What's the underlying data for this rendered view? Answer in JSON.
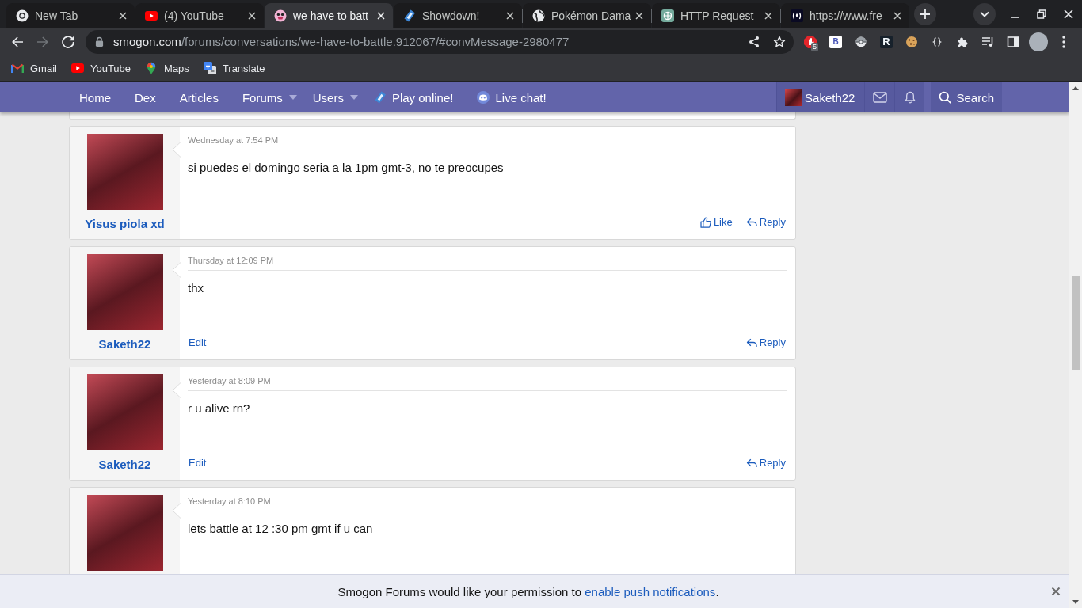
{
  "browser": {
    "tabs": [
      {
        "title": "New Tab",
        "kind": "ring",
        "selected": false
      },
      {
        "title": "(4) YouTube",
        "kind": "play",
        "selected": false
      },
      {
        "title": "we have to batt",
        "kind": "face",
        "selected": true
      },
      {
        "title": "Showdown!",
        "kind": "diamond",
        "selected": false
      },
      {
        "title": "Pokémon Dama",
        "kind": "globe",
        "selected": false
      },
      {
        "title": "HTTP Request",
        "kind": "flower",
        "selected": false
      },
      {
        "title": "https://www.fre",
        "kind": "flame",
        "selected": false
      }
    ],
    "nav_buttons": [
      {
        "kind": "back",
        "disabled": false
      },
      {
        "kind": "forward",
        "disabled": true
      },
      {
        "kind": "reload",
        "disabled": false
      }
    ],
    "address": {
      "host": "smogon.com",
      "path": "/forums/conversations/we-have-to-battle.912067/#convMessage-2980477"
    },
    "extensions": [
      {
        "kind": "stop",
        "badge": "5"
      },
      {
        "kind": "tile-light",
        "glyph": "B"
      },
      {
        "kind": "ball"
      },
      {
        "kind": "tile-dark",
        "glyph": "R"
      },
      {
        "kind": "cookie"
      },
      {
        "kind": "braces"
      }
    ],
    "bookmarks": [
      {
        "label": "Gmail",
        "kind": "mail"
      },
      {
        "label": "YouTube",
        "kind": "play"
      },
      {
        "label": "Maps",
        "kind": "pin"
      },
      {
        "label": "Translate",
        "kind": "translate"
      }
    ]
  },
  "site_nav": {
    "items": [
      {
        "label": "Home",
        "kind": "link"
      },
      {
        "label": "Dex",
        "kind": "link"
      },
      {
        "label": "Articles",
        "kind": "link"
      },
      {
        "label": "Forums",
        "kind": "dropdown"
      },
      {
        "label": "Users",
        "kind": "dropdown"
      },
      {
        "label": "Play online!",
        "kind": "showdown"
      },
      {
        "label": "Live chat!",
        "kind": "chat"
      }
    ],
    "account": {
      "username": "Saketh22"
    },
    "search": {
      "label": "Search"
    }
  },
  "messages": [
    {
      "author": "Yisus piola xd",
      "time": "Wednesday at 7:54 PM",
      "text": "si puedes el domingo seria a la 1pm gmt-3, no te preocupes",
      "actions": [
        {
          "kind": "like",
          "label": "Like"
        },
        {
          "kind": "reply",
          "label": "Reply"
        }
      ]
    },
    {
      "author": "Saketh22",
      "time": "Thursday at 12:09 PM",
      "text": "thx",
      "actions": [
        {
          "kind": "edit",
          "label": "Edit"
        },
        {
          "kind": "reply",
          "label": "Reply"
        }
      ]
    },
    {
      "author": "Saketh22",
      "time": "Yesterday at 8:09 PM",
      "text": "r u alive rn?",
      "actions": [
        {
          "kind": "edit",
          "label": "Edit"
        },
        {
          "kind": "reply",
          "label": "Reply"
        }
      ]
    },
    {
      "time": "Yesterday at 8:10 PM",
      "text": "lets battle at 12 :30 pm gmt if u can"
    }
  ],
  "notification": {
    "text": "Smogon Forums would like your permission to ",
    "link": "enable push notifications",
    "suffix": "."
  }
}
